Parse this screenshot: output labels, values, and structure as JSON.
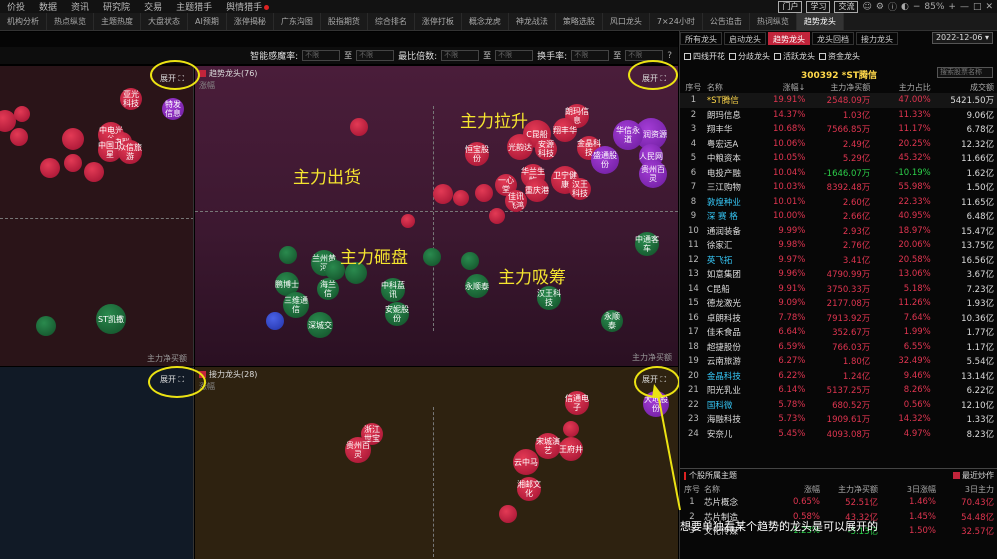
{
  "menu": [
    "价投",
    "数据",
    "资讯",
    "研究院",
    "交易",
    "主题猎手",
    "舆情猎手"
  ],
  "menu_buttons": [
    "门户",
    "学习",
    "交流"
  ],
  "zoom": "85%",
  "tabs": [
    "机构分析",
    "热点纵览",
    "主题热度",
    "大盘状态",
    "AI预期",
    "涨停揭秘",
    "广东沟图",
    "股指期货",
    "综合排名",
    "涨停打板",
    "概念龙虎",
    "神龙战法",
    "策略选股",
    "风口龙头",
    "7×24小时",
    "公告追击",
    "热词纵览",
    "趋势龙头"
  ],
  "filters": {
    "f1_label": "智能感魔率:",
    "f2_label": "最比倍数:",
    "f3_label": "换手率:",
    "placeholder": "不限",
    "to": "至"
  },
  "panels": {
    "trend_name": "趋势龙头(76)",
    "bottom_name": "接力龙头(28)",
    "y_label": "涨幅",
    "x_label": "主力净买额",
    "expand": "展开"
  },
  "zones": {
    "top_right": "主力拉升",
    "top_left": "主力出货",
    "bottom_left": "主力砸盘",
    "bottom_right": "主力吸筹"
  },
  "bubbles": {
    "tl": [
      "亚光科技",
      "特发信息",
      "中电光谷",
      "电联",
      "中国卫星",
      "铁路通信",
      "众信旅游",
      "ST凯撒"
    ],
    "tr": [
      "朗玛信息",
      "翔丰华",
      "*ST腾信",
      "C昆船",
      "安源科技",
      "中润资源",
      "金晶科技",
      "华信永道",
      "盛通股份",
      "人民网",
      "贵州百灵",
      "恒宝股份",
      "光韵达",
      "卫宁健康",
      "一心堂",
      "华兰生物",
      "重庆港",
      "佳讯飞鸿",
      "汉王科技",
      "远方信息",
      "佳发教育",
      "零点有数",
      "福安药业",
      "天际股份",
      "晋控电力",
      "兰州黄河",
      "鹏博士",
      "海兰信",
      "三维通信",
      "安妮股份",
      "深城交",
      "中科蓝讯",
      "永顺泰",
      "中通客车",
      "延华智能"
    ],
    "br": [
      "浙江世宝",
      "贵州百灵",
      "宋城演艺",
      "王府井",
      "云中马",
      "湘邮文化",
      "信通电子",
      "大地股份"
    ]
  },
  "right": {
    "subtabs": [
      "所有龙头",
      "启动龙头",
      "趋势龙头",
      "龙头回档",
      "接力龙头"
    ],
    "date": "2022-12-06",
    "checks": [
      "四线开花",
      "分歧龙头",
      "活跃龙头",
      "资金龙头"
    ],
    "stock_title": "300392 *ST腾信",
    "search_placeholder": "搜索股票名称",
    "columns": [
      "序号",
      "名称",
      "涨幅↓",
      "主力净买额",
      "主力占比",
      "成交额"
    ],
    "rows": [
      [
        "1",
        "*ST腾信",
        "19.91%",
        "2548.09万",
        "47.00%",
        "5421.50万"
      ],
      [
        "2",
        "朗玛信息",
        "14.37%",
        "1.03亿",
        "11.33%",
        "9.06亿"
      ],
      [
        "3",
        "翔丰华",
        "10.68%",
        "7566.85万",
        "11.17%",
        "6.78亿"
      ],
      [
        "4",
        "粤宏远A",
        "10.06%",
        "2.49亿",
        "20.25%",
        "12.32亿"
      ],
      [
        "5",
        "中粮资本",
        "10.05%",
        "5.29亿",
        "45.32%",
        "11.66亿"
      ],
      [
        "6",
        "电投产融",
        "10.04%",
        "-1646.07万",
        "-10.19%",
        "1.62亿"
      ],
      [
        "7",
        "三江购物",
        "10.03%",
        "8392.48万",
        "55.98%",
        "1.50亿"
      ],
      [
        "8",
        "敦煌种业",
        "10.01%",
        "2.60亿",
        "22.33%",
        "11.65亿"
      ],
      [
        "9",
        "深 赛 格",
        "10.00%",
        "2.66亿",
        "40.95%",
        "6.48亿"
      ],
      [
        "10",
        "通润装备",
        "9.99%",
        "2.93亿",
        "18.97%",
        "15.47亿"
      ],
      [
        "11",
        "徐家汇",
        "9.98%",
        "2.76亿",
        "20.06%",
        "13.75亿"
      ],
      [
        "12",
        "英飞拓",
        "9.97%",
        "3.41亿",
        "20.58%",
        "16.56亿"
      ],
      [
        "13",
        "如意集团",
        "9.96%",
        "4790.99万",
        "13.06%",
        "3.67亿"
      ],
      [
        "14",
        "C昆船",
        "9.91%",
        "3750.33万",
        "5.18%",
        "7.23亿"
      ],
      [
        "15",
        "德龙激光",
        "9.09%",
        "2177.08万",
        "11.26%",
        "1.93亿"
      ],
      [
        "16",
        "卓朗科技",
        "7.78%",
        "7913.92万",
        "7.64%",
        "10.36亿"
      ],
      [
        "17",
        "佳禾食品",
        "6.64%",
        "352.67万",
        "1.99%",
        "1.77亿"
      ],
      [
        "18",
        "超捷股份",
        "6.59%",
        "766.03万",
        "6.55%",
        "1.17亿"
      ],
      [
        "19",
        "云南旅游",
        "6.27%",
        "1.80亿",
        "32.49%",
        "5.54亿"
      ],
      [
        "20",
        "金晶科技",
        "6.22%",
        "1.24亿",
        "9.46%",
        "13.14亿"
      ],
      [
        "21",
        "阳光乳业",
        "6.14%",
        "5137.25万",
        "8.26%",
        "6.22亿"
      ],
      [
        "22",
        "国科微",
        "5.78%",
        "680.52万",
        "0.56%",
        "12.10亿"
      ],
      [
        "23",
        "海融科技",
        "5.73%",
        "1909.61万",
        "14.32%",
        "1.33亿"
      ],
      [
        "24",
        "安奈儿",
        "5.45%",
        "4093.08万",
        "4.97%",
        "8.23亿"
      ]
    ],
    "sector_title": "个股所属主题",
    "sector_checkbox": "最近炒作",
    "sector_columns": [
      "序号",
      "名称",
      "涨幅",
      "主力净买额",
      "3日涨幅",
      "3日主力"
    ],
    "sector_rows": [
      [
        "1",
        "芯片概念",
        "0.65%",
        "52.51亿",
        "1.46%",
        "70.43亿"
      ],
      [
        "2",
        "芯片制造",
        "0.58%",
        "43.32亿",
        "1.45%",
        "54.48亿"
      ],
      [
        "3",
        "文化传媒",
        "-1.23%",
        "-5.13亿",
        "1.50%",
        "32.57亿"
      ]
    ]
  },
  "annotation": "想要单独看某个趋势的龙头是可以展开的",
  "colors": {
    "accent_red": "#c2243b",
    "up_red": "#e03550",
    "down_green": "#2ccf4a",
    "label_yellow": "#f5e52f",
    "highlight_ring": "#ece313",
    "panel_trend_bg": "#3c1830",
    "panel_relay_bg": "#2e2210"
  }
}
